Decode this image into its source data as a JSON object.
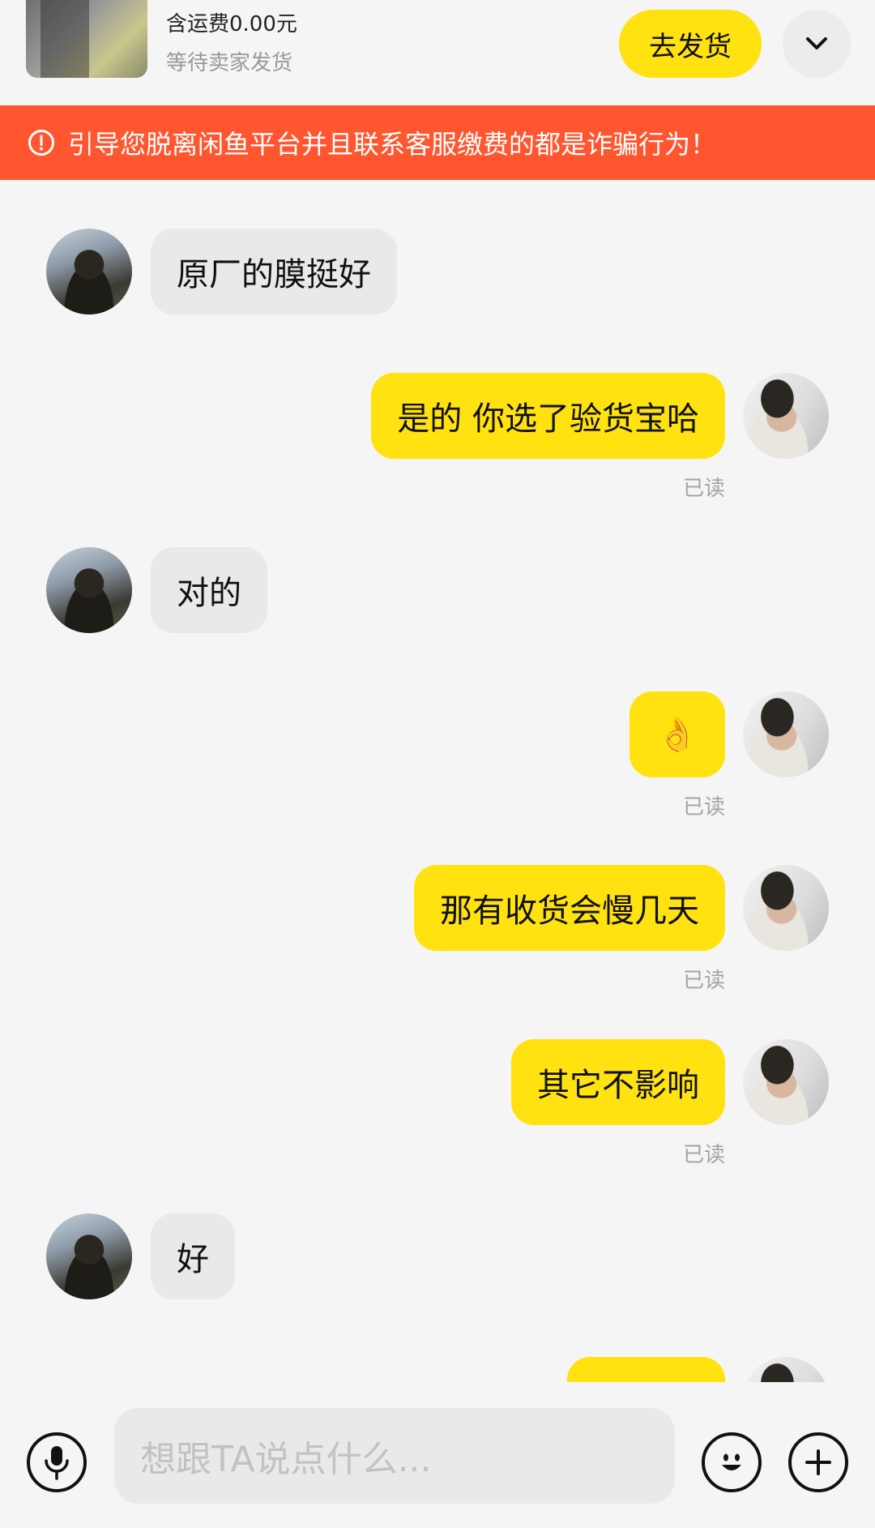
{
  "order": {
    "shipping": "含运费0.00元",
    "status": "等待卖家发货",
    "ship_button_label": "去发货",
    "collapse_icon": "chevron-down-icon"
  },
  "warning": {
    "icon": "exclamation-circle-icon",
    "text": "引导您脱离闲鱼平台并且联系客服缴费的都是诈骗行为！"
  },
  "messages": [
    {
      "from": "peer",
      "text": "原厂的膜挺好"
    },
    {
      "from": "self",
      "text": "是的 你选了验货宝哈",
      "status": "已读"
    },
    {
      "from": "peer",
      "text": "对的"
    },
    {
      "from": "self",
      "text": "👌",
      "status": "已读"
    },
    {
      "from": "self",
      "text": "那有收货会慢几天",
      "status": "已读"
    },
    {
      "from": "self",
      "text": "其它不影响",
      "status": "已读"
    },
    {
      "from": "peer",
      "text": "好"
    },
    {
      "from": "self",
      "text": ""
    }
  ],
  "composer": {
    "placeholder": "想跟TA说点什么...",
    "voice_icon": "microphone-icon",
    "emoji_icon": "smiley-icon",
    "plus_icon": "plus-icon"
  },
  "colors": {
    "accent": "#ffe20f",
    "warning": "#ff5630",
    "peer_bubble": "#e9e9ea",
    "background": "#f5f5f5"
  }
}
